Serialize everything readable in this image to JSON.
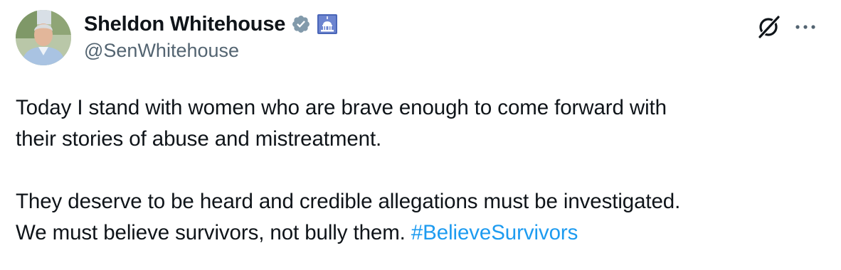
{
  "author": {
    "display_name": "Sheldon Whitehouse",
    "handle": "@SenWhitehouse",
    "verified_badge_icon": "verified-check-icon",
    "affiliation_badge_icon": "capitol-dome-icon",
    "badge_color": "#829aab",
    "affiliation_badge_color": "#4a66b8"
  },
  "actions": {
    "grok_icon": "grok-icon",
    "more_icon": "more-dots-icon"
  },
  "tweet": {
    "line1": "Today I stand with women who are brave enough to come forward with",
    "line2": "their stories of abuse and mistreatment.",
    "line3": "They deserve to be heard and credible allegations must be investigated.",
    "line4_text": "We must believe survivors, not bully them. ",
    "hashtag": "#BelieveSurvivors",
    "link_color": "#1d9bf0"
  }
}
